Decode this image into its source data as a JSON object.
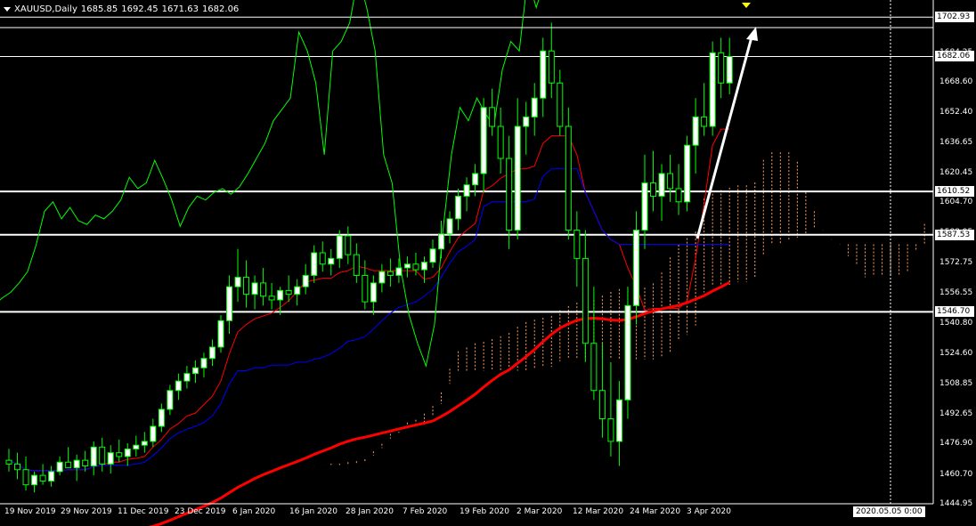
{
  "header": {
    "symbol": "XAUUSD,Daily",
    "open": "1685.85",
    "high": "1692.45",
    "low": "1671.63",
    "close": "1682.06"
  },
  "price_axis": {
    "ticks": [
      "1702.93",
      "1684.25",
      "1668.60",
      "1652.40",
      "1636.65",
      "1620.45",
      "1604.70",
      "1588.95",
      "1572.75",
      "1556.55",
      "1540.80",
      "1524.60",
      "1508.85",
      "1492.65",
      "1476.90",
      "1460.70",
      "1444.95"
    ],
    "labels": [
      {
        "value": "1702.93",
        "style": "box-white"
      },
      {
        "value": "1682.06",
        "style": "box-white"
      },
      {
        "value": "1610.52",
        "style": "box-white"
      },
      {
        "value": "1587.53",
        "style": "box-white"
      },
      {
        "value": "1546.70",
        "style": "box-white"
      }
    ]
  },
  "time_axis": {
    "ticks": [
      "19 Nov 2019",
      "29 Nov 2019",
      "11 Dec 2019",
      "23 Dec 2019",
      "6 Jan 2020",
      "16 Jan 2020",
      "28 Jan 2020",
      "7 Feb 2020",
      "19 Feb 2020",
      "2 Mar 2020",
      "12 Mar 2020",
      "24 Mar 2020",
      "3 Apr 2020"
    ],
    "cursor_label": "2020.05.05 0:00"
  },
  "colors": {
    "background": "#000000",
    "bull": "#ffffff",
    "bear": "#000000",
    "wick": "#00ff00",
    "candle_border": "#00ff00",
    "tenkan": "#ff0000",
    "kijun": "#0000ff",
    "chikou": "#00ff00",
    "ma": "#ff0000",
    "cloud": "#ffa060",
    "hline": "#ffffff",
    "arrow": "#ffffff",
    "marker": "#ffff00"
  },
  "chart_data": {
    "type": "candlestick",
    "ylim": [
      1444.95,
      1712
    ],
    "horizontal_lines": [
      1702.93,
      1682.06,
      1610.52,
      1587.53,
      1546.7
    ],
    "candles": [
      [
        1468,
        1474,
        1462,
        1466
      ],
      [
        1466,
        1472,
        1458,
        1463
      ],
      [
        1463,
        1470,
        1452,
        1455
      ],
      [
        1455,
        1462,
        1451,
        1460
      ],
      [
        1460,
        1466,
        1455,
        1457
      ],
      [
        1457,
        1465,
        1454,
        1462
      ],
      [
        1462,
        1470,
        1460,
        1467
      ],
      [
        1467,
        1475,
        1465,
        1464
      ],
      [
        1464,
        1471,
        1457,
        1468
      ],
      [
        1468,
        1473,
        1462,
        1465
      ],
      [
        1465,
        1478,
        1460,
        1475
      ],
      [
        1475,
        1480,
        1462,
        1466
      ],
      [
        1466,
        1476,
        1461,
        1472
      ],
      [
        1472,
        1479,
        1467,
        1470
      ],
      [
        1470,
        1477,
        1465,
        1474
      ],
      [
        1474,
        1481,
        1470,
        1476
      ],
      [
        1476,
        1483,
        1472,
        1478
      ],
      [
        1478,
        1490,
        1475,
        1486
      ],
      [
        1486,
        1498,
        1483,
        1495
      ],
      [
        1495,
        1508,
        1492,
        1505
      ],
      [
        1505,
        1514,
        1500,
        1510
      ],
      [
        1510,
        1518,
        1506,
        1514
      ],
      [
        1514,
        1521,
        1509,
        1517
      ],
      [
        1517,
        1525,
        1512,
        1522
      ],
      [
        1522,
        1532,
        1518,
        1528
      ],
      [
        1528,
        1545,
        1525,
        1542
      ],
      [
        1542,
        1566,
        1535,
        1560
      ],
      [
        1560,
        1580,
        1552,
        1565
      ],
      [
        1565,
        1574,
        1549,
        1556
      ],
      [
        1556,
        1566,
        1548,
        1562
      ],
      [
        1562,
        1570,
        1550,
        1555
      ],
      [
        1555,
        1562,
        1548,
        1553
      ],
      [
        1553,
        1560,
        1545,
        1558
      ],
      [
        1558,
        1566,
        1552,
        1556
      ],
      [
        1556,
        1564,
        1550,
        1560
      ],
      [
        1560,
        1572,
        1556,
        1566
      ],
      [
        1566,
        1582,
        1562,
        1578
      ],
      [
        1578,
        1584,
        1568,
        1572
      ],
      [
        1572,
        1580,
        1566,
        1575
      ],
      [
        1575,
        1590,
        1570,
        1587
      ],
      [
        1587,
        1592,
        1572,
        1577
      ],
      [
        1577,
        1583,
        1562,
        1566
      ],
      [
        1566,
        1574,
        1548,
        1552
      ],
      [
        1552,
        1566,
        1545,
        1562
      ],
      [
        1562,
        1572,
        1557,
        1568
      ],
      [
        1568,
        1575,
        1560,
        1566
      ],
      [
        1566,
        1575,
        1562,
        1570
      ],
      [
        1570,
        1576,
        1565,
        1572
      ],
      [
        1572,
        1578,
        1566,
        1569
      ],
      [
        1569,
        1576,
        1562,
        1573
      ],
      [
        1573,
        1585,
        1570,
        1580
      ],
      [
        1580,
        1595,
        1575,
        1588
      ],
      [
        1588,
        1600,
        1583,
        1596
      ],
      [
        1596,
        1612,
        1590,
        1608
      ],
      [
        1608,
        1618,
        1600,
        1614
      ],
      [
        1614,
        1625,
        1608,
        1620
      ],
      [
        1620,
        1660,
        1610,
        1655
      ],
      [
        1655,
        1665,
        1640,
        1645
      ],
      [
        1645,
        1655,
        1620,
        1628
      ],
      [
        1628,
        1640,
        1580,
        1590
      ],
      [
        1590,
        1660,
        1585,
        1645
      ],
      [
        1645,
        1658,
        1630,
        1650
      ],
      [
        1650,
        1668,
        1640,
        1660
      ],
      [
        1660,
        1692,
        1650,
        1685
      ],
      [
        1685,
        1700,
        1660,
        1668
      ],
      [
        1668,
        1675,
        1640,
        1645
      ],
      [
        1645,
        1655,
        1585,
        1590
      ],
      [
        1590,
        1600,
        1560,
        1575
      ],
      [
        1575,
        1590,
        1520,
        1530
      ],
      [
        1530,
        1560,
        1500,
        1505
      ],
      [
        1505,
        1530,
        1480,
        1490
      ],
      [
        1490,
        1520,
        1470,
        1478
      ],
      [
        1478,
        1510,
        1465,
        1500
      ],
      [
        1500,
        1560,
        1490,
        1550
      ],
      [
        1550,
        1600,
        1540,
        1590
      ],
      [
        1590,
        1630,
        1580,
        1615
      ],
      [
        1615,
        1632,
        1600,
        1608
      ],
      [
        1608,
        1625,
        1595,
        1620
      ],
      [
        1620,
        1630,
        1605,
        1612
      ],
      [
        1612,
        1625,
        1598,
        1605
      ],
      [
        1605,
        1640,
        1600,
        1635
      ],
      [
        1635,
        1660,
        1620,
        1650
      ],
      [
        1650,
        1668,
        1640,
        1645
      ],
      [
        1645,
        1690,
        1640,
        1684
      ],
      [
        1684,
        1692,
        1660,
        1668
      ],
      [
        1668,
        1692,
        1662,
        1682
      ]
    ]
  }
}
